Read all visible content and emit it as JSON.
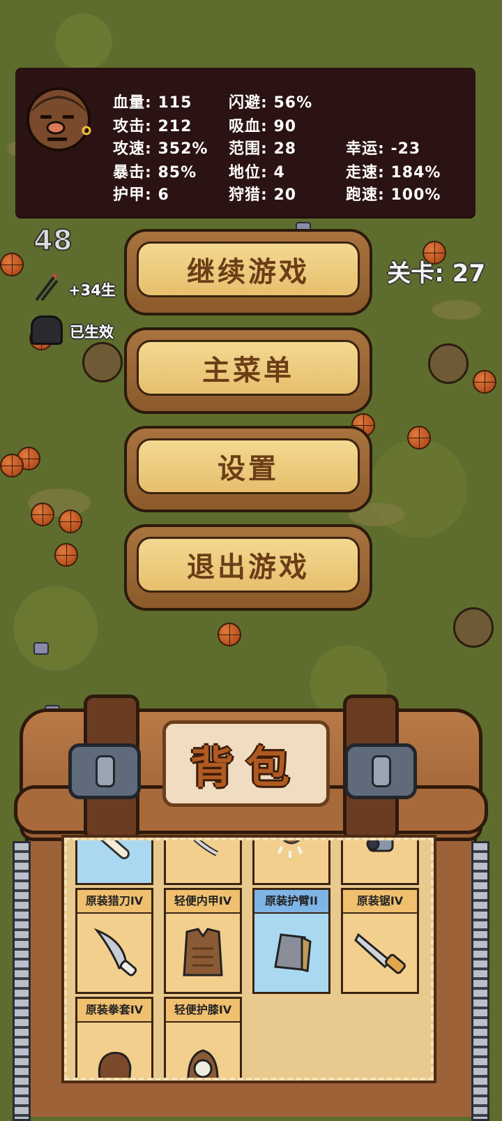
{
  "stats": {
    "rows": [
      [
        "血量: 115",
        "闪避: 56%",
        ""
      ],
      [
        "攻击: 212",
        "吸血: 90",
        ""
      ],
      [
        "攻速: 352%",
        "范围: 28",
        "幸运: -23"
      ],
      [
        "暴击: 85%",
        "地位: 4",
        "走速: 184%"
      ],
      [
        "护甲: 6",
        "狩猎: 20",
        "跑速: 100%"
      ]
    ]
  },
  "hud": {
    "count": "48",
    "bonus": "+34生",
    "effect": "已生效",
    "level": "关卡: 27"
  },
  "menu": {
    "continue": "继续游戏",
    "main_menu": "主菜单",
    "settings": "设置",
    "quit": "退出游戏"
  },
  "backpack": {
    "title": "背包",
    "items": [
      {
        "name": "",
        "icon": "bone-icon",
        "rarity": "blue"
      },
      {
        "name": "",
        "icon": "rope-icon",
        "rarity": "orange"
      },
      {
        "name": "",
        "icon": "claw-icon",
        "rarity": "orange"
      },
      {
        "name": "",
        "icon": "scope-icon",
        "rarity": "orange"
      },
      {
        "name": "原装猎刀IV",
        "icon": "hunting-knife-icon",
        "rarity": "orange"
      },
      {
        "name": "轻便内甲IV",
        "icon": "vest-icon",
        "rarity": "orange"
      },
      {
        "name": "原装护臂II",
        "icon": "bracer-icon",
        "rarity": "blue"
      },
      {
        "name": "原装锯IV",
        "icon": "saw-icon",
        "rarity": "orange"
      },
      {
        "name": "原装拳套IV",
        "icon": "glove-icon",
        "rarity": "orange"
      },
      {
        "name": "轻便护膝IV",
        "icon": "knee-pad-icon",
        "rarity": "orange"
      }
    ]
  }
}
